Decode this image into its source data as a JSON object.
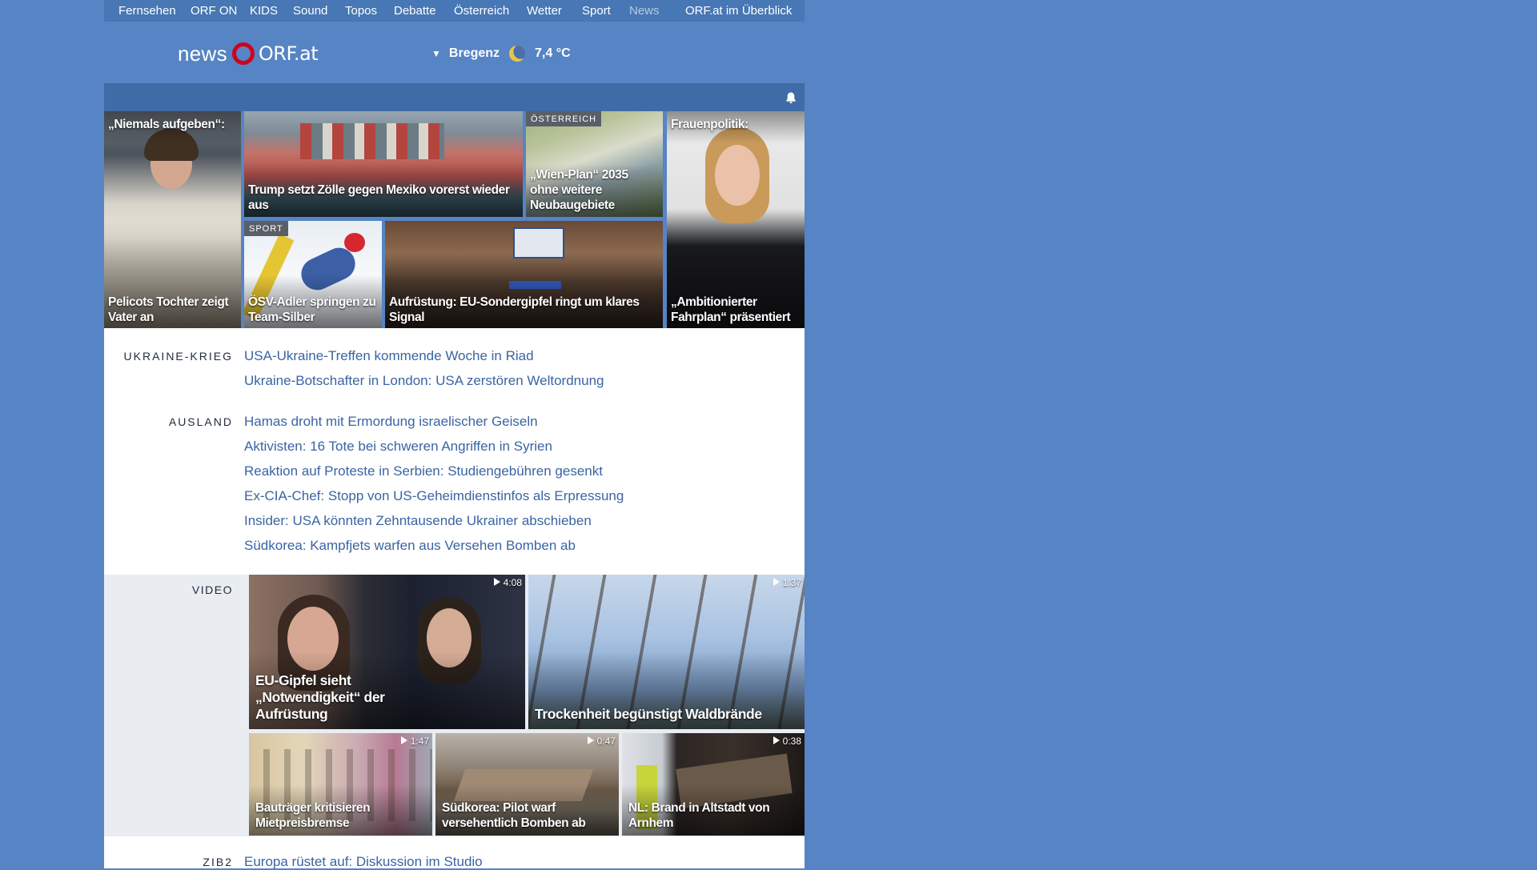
{
  "topnav": {
    "items": [
      "Fernsehen",
      "ORF ON",
      "KIDS",
      "Sound",
      "Topos",
      "Debatte",
      "Österreich",
      "Wetter",
      "Sport",
      "News"
    ],
    "current": "News",
    "overview": "ORF.at im Überblick"
  },
  "header": {
    "logo_news": "news",
    "logo_orf": "ORF.at",
    "weather_city": "Bregenz",
    "weather_temp": "7,4 °C"
  },
  "hero": [
    {
      "title": "„Niemals aufgeben“:",
      "subtitle": "Pelicots Tochter zeigt Vater an"
    },
    {
      "title": "Trump setzt Zölle gegen Mexiko vorerst wieder aus"
    },
    {
      "badge": "ÖSTERREICH",
      "title": "„Wien-Plan“ 2035 ohne weitere Neubaugebiete"
    },
    {
      "title": "Frauenpolitik:",
      "subtitle": "„Ambitionierter Fahrplan“ präsentiert"
    },
    {
      "badge": "SPORT",
      "title": "ÖSV-Adler springen zu Team-Silber"
    },
    {
      "title": "Aufrüstung: EU-Sondergipfel ringt um klares Signal"
    }
  ],
  "sections": [
    {
      "label": "UKRAINE-KRIEG",
      "headlines": [
        "USA-Ukraine-Treffen kommende Woche in Riad",
        "Ukraine-Botschafter in London: USA zerstören Weltordnung"
      ]
    },
    {
      "label": "AUSLAND",
      "headlines": [
        "Hamas droht mit Ermordung israelischer Geiseln",
        "Aktivisten: 16 Tote bei schweren Angriffen in Syrien",
        "Reaktion auf Proteste in Serbien: Studiengebühren gesenkt",
        "Ex-CIA-Chef: Stopp von US-Geheimdienstinfos als Erpressung",
        "Insider: USA könnten Zehntausende Ukrainer abschieben",
        "Südkorea: Kampfjets warfen aus Versehen Bomben ab"
      ]
    }
  ],
  "video": {
    "label": "VIDEO",
    "items": [
      {
        "title": "EU-Gipfel sieht „Notwendigkeit“ der Aufrüstung",
        "duration": "4:08"
      },
      {
        "title": "Trockenheit begünstigt Waldbrände",
        "duration": "1:37"
      },
      {
        "title": "Bauträger kritisieren Mietpreisbremse",
        "duration": "1:47"
      },
      {
        "title": "Südkorea: Pilot warf versehentlich Bomben ab",
        "duration": "0:47"
      },
      {
        "title": "NL: Brand in Altstadt von Arnhem",
        "duration": "0:38"
      }
    ]
  },
  "zib": {
    "label": "ZIB2",
    "headline": "Europa rüstet auf: Diskussion im Studio"
  }
}
